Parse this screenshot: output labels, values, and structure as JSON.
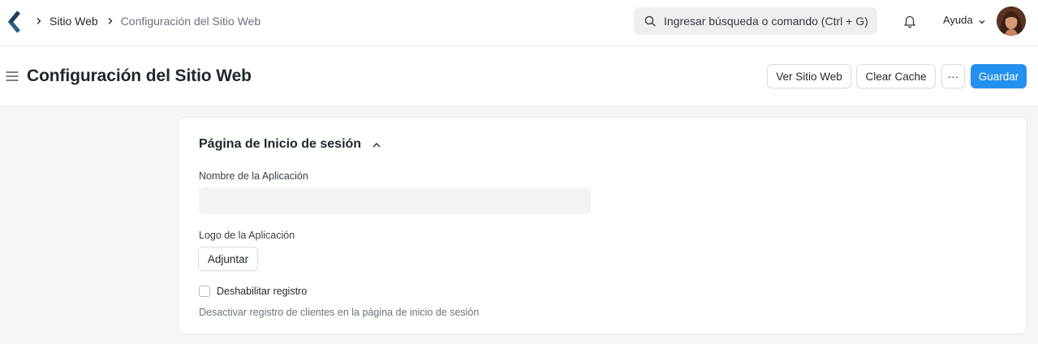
{
  "navbar": {
    "breadcrumbs": [
      "Sitio Web",
      "Configuración del Sitio Web"
    ],
    "search_placeholder": "Ingresar búsqueda o comando (Ctrl + G)",
    "help_label": "Ayuda"
  },
  "page": {
    "title": "Configuración del Sitio Web",
    "actions": {
      "view_site": "Ver Sitio Web",
      "clear_cache": "Clear Cache",
      "more": "···",
      "save": "Guardar"
    }
  },
  "section": {
    "title": "Página de Inicio de sesión",
    "fields": {
      "app_name_label": "Nombre de la Aplicación",
      "app_name_value": "",
      "app_logo_label": "Logo de la Aplicación",
      "attach_label": "Adjuntar",
      "disable_signup_label": "Deshabilitar registro",
      "disable_signup_checked": false,
      "disable_signup_description": "Desactivar registro de clientes en la página de inicio de sesión"
    }
  },
  "colors": {
    "primary": "#2490ef",
    "logo": "#2a5d84",
    "background": "#f4f5f6"
  }
}
